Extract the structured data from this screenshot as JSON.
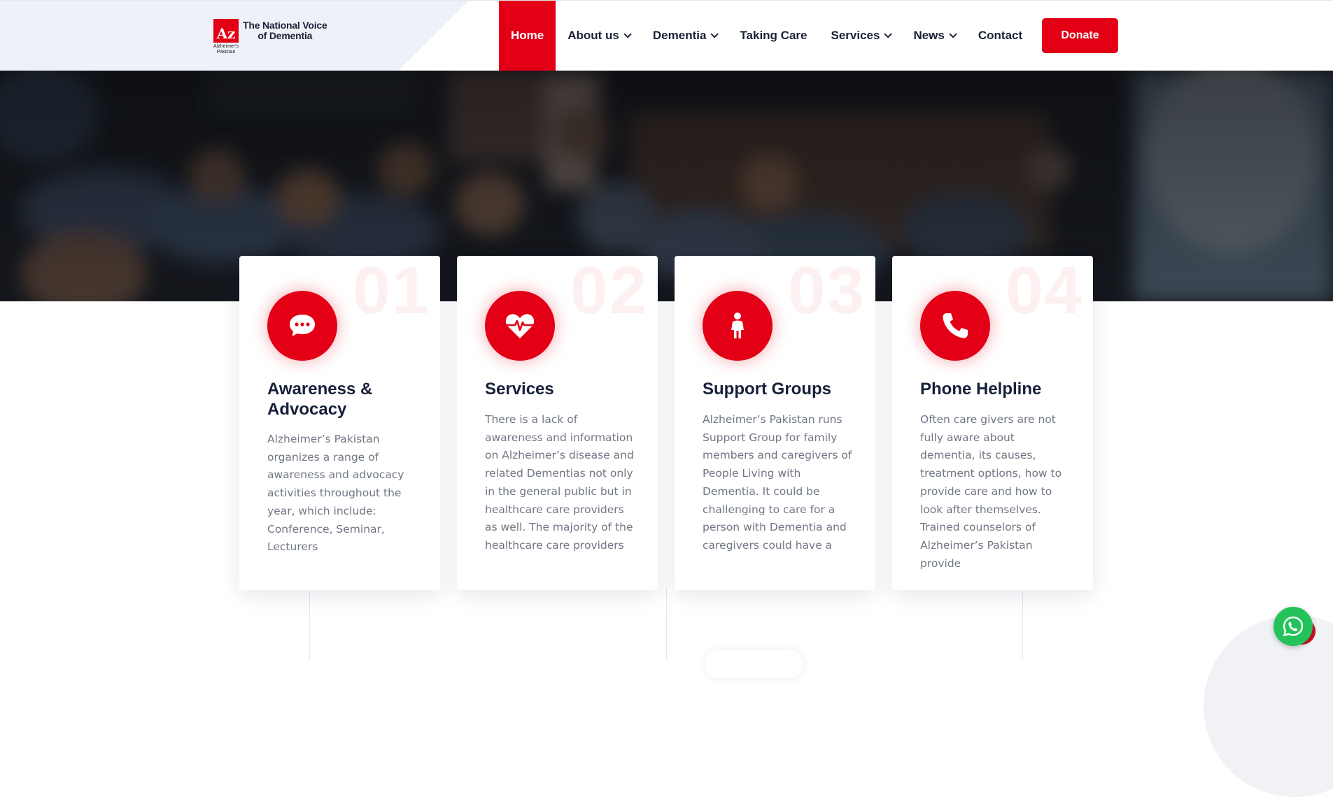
{
  "brand": {
    "logo_letters": "Az",
    "logo_small": "Alzheimer's Pakistan",
    "tagline_line1": "The National Voice",
    "tagline_line2": "of Dementia",
    "accent": "#e30016"
  },
  "nav": {
    "home": "Home",
    "about": "About us",
    "dementia": "Dementia",
    "taking_care": "Taking Care",
    "services": "Services",
    "news": "News",
    "contact": "Contact",
    "donate": "Donate"
  },
  "cards": [
    {
      "number": "01",
      "icon": "chat-bubble-icon",
      "title": "Awareness & Advocacy",
      "text": "Alzheimer’s Pakistan organizes a range of awareness and advocacy activities throughout the year, which include: Conference, Seminar, Lecturers"
    },
    {
      "number": "02",
      "icon": "heart-pulse-icon",
      "title": "Services",
      "text": "There is a lack of awareness and information on Alzheimer’s disease and related Dementias not only in the general public but in healthcare care providers as well. The majority of the healthcare care providers"
    },
    {
      "number": "03",
      "icon": "person-icon",
      "title": "Support Groups",
      "text": "Alzheimer’s Pakistan runs Support Group for family members and caregivers of People Living with Dementia. It could be challenging to care for a person with Dementia and caregivers could have a"
    },
    {
      "number": "04",
      "icon": "phone-icon",
      "title": "Phone Helpline",
      "text": "Often care givers are not fully aware about dementia, its causes, treatment options, how to provide care and how to look after themselves. Trained counselors of Alzheimer’s Pakistan provide"
    }
  ],
  "floating": {
    "icon": "whatsapp-icon"
  }
}
